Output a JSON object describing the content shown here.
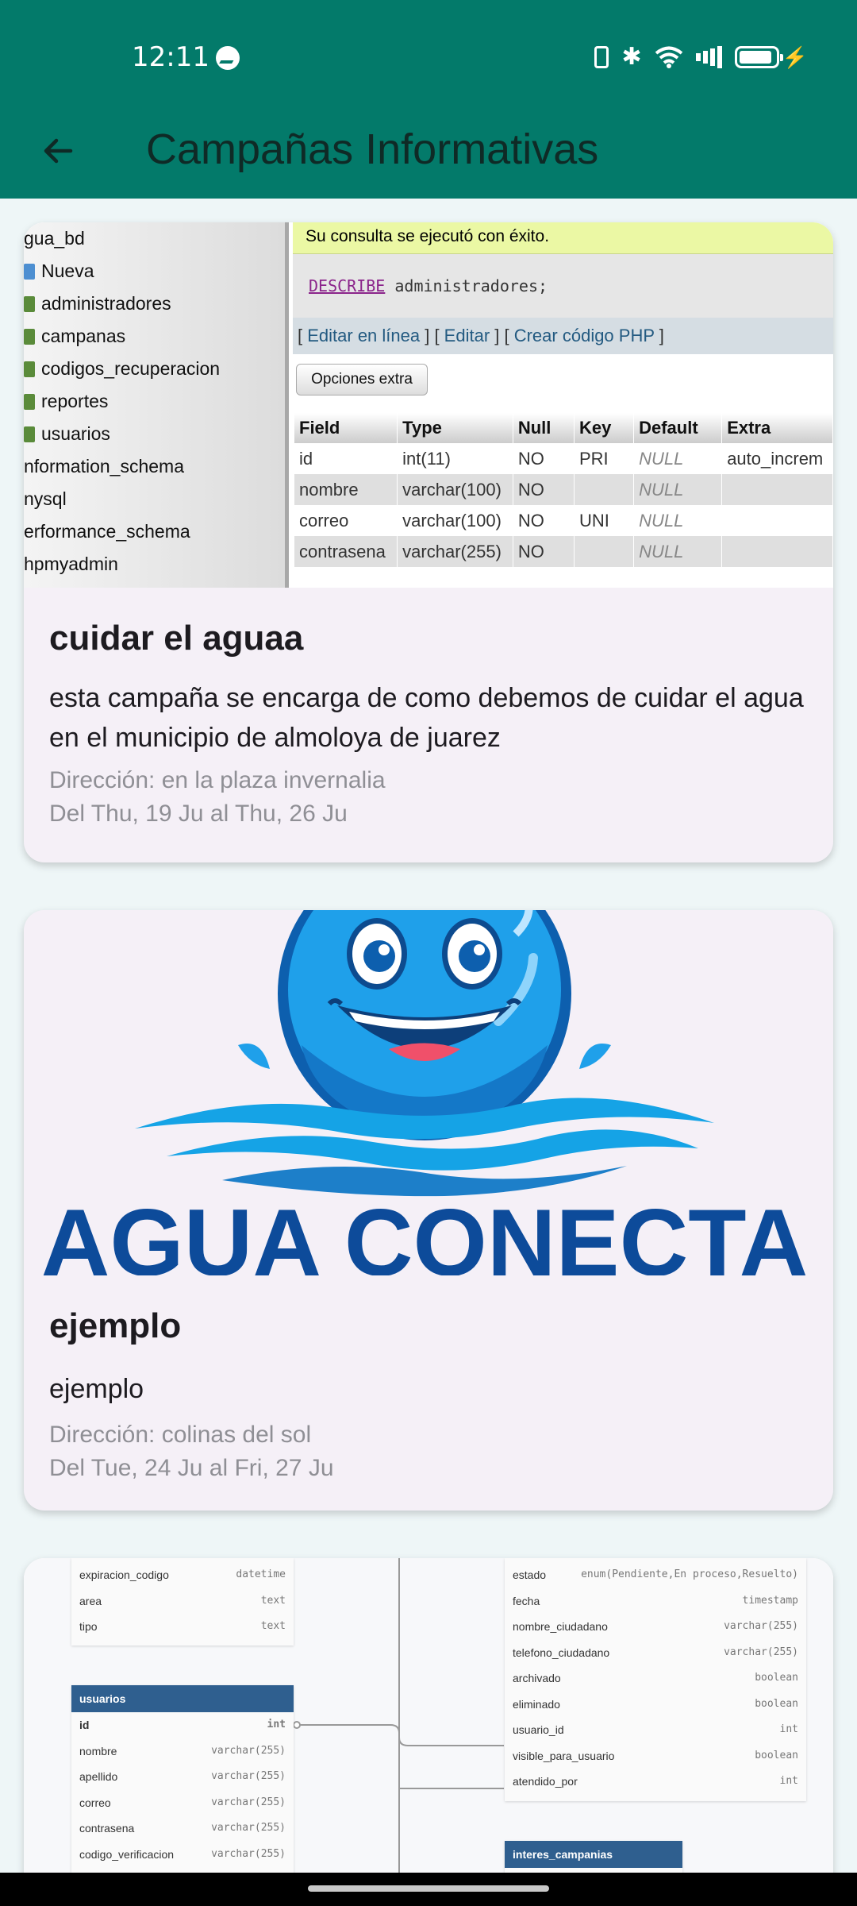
{
  "status_bar": {
    "time": "12:11",
    "icons": [
      "messenger-icon",
      "vibrate-icon",
      "bluetooth-icon",
      "wifi-icon",
      "signal-icon",
      "battery-icon",
      "charging-bolt-icon"
    ]
  },
  "app_bar": {
    "title": "Campañas Informativas",
    "back_icon": "arrow-back-icon",
    "color": "#037a6a"
  },
  "campaigns": [
    {
      "title": "cuidar el aguaa",
      "description": "esta campaña se encarga de como debemos de cuidar el agua en el municipio de almoloya de juarez",
      "address": "Dirección: en la plaza invernalia",
      "dates": "Del Thu, 19 Ju al Thu, 26 Ju",
      "image": {
        "sidebar": [
          "gua_bd",
          "Nueva",
          "administradores",
          "campanas",
          "codigos_recuperacion",
          "reportes",
          "usuarios",
          "nformation_schema",
          "nysql",
          "erformance_schema",
          "hpmyadmin"
        ],
        "success_msg": "Su consulta se ejecutó con éxito.",
        "sql_keyword": "DESCRIBE",
        "sql_rest": "administradores;",
        "links": [
          "Editar en línea",
          "Editar",
          "Crear código PHP"
        ],
        "button": "Opciones extra",
        "columns": [
          "Field",
          "Type",
          "Null",
          "Key",
          "Default",
          "Extra"
        ],
        "rows": [
          [
            "id",
            "int(11)",
            "NO",
            "PRI",
            "NULL",
            "auto_increm"
          ],
          [
            "nombre",
            "varchar(100)",
            "NO",
            "",
            "NULL",
            ""
          ],
          [
            "correo",
            "varchar(100)",
            "NO",
            "UNI",
            "NULL",
            ""
          ],
          [
            "contrasena",
            "varchar(255)",
            "NO",
            "",
            "NULL",
            ""
          ]
        ]
      }
    },
    {
      "title": "ejemplo",
      "description": "ejemplo",
      "address": "Dirección: colinas del sol",
      "dates": "Del Tue, 24 Ju al Fri, 27 Ju",
      "image": {
        "logo_text": "AGUA CONECTA"
      }
    },
    {
      "image": {
        "left_rows": [
          [
            "expiracion_codigo",
            "datetime"
          ],
          [
            "area",
            "text"
          ],
          [
            "tipo",
            "text"
          ]
        ],
        "usuarios_title": "usuarios",
        "usuarios_rows": [
          [
            "id",
            "int"
          ],
          [
            "nombre",
            "varchar(255)"
          ],
          [
            "apellido",
            "varchar(255)"
          ],
          [
            "correo",
            "varchar(255)"
          ],
          [
            "contrasena",
            "varchar(255)"
          ],
          [
            "codigo_verificacion",
            "varchar(255)"
          ]
        ],
        "right_rows": [
          [
            "estado",
            "enum(Pendiente,En proceso,Resuelto)"
          ],
          [
            "fecha",
            "timestamp"
          ],
          [
            "nombre_ciudadano",
            "varchar(255)"
          ],
          [
            "telefono_ciudadano",
            "varchar(255)"
          ],
          [
            "archivado",
            "boolean"
          ],
          [
            "eliminado",
            "boolean"
          ],
          [
            "usuario_id",
            "int"
          ],
          [
            "visible_para_usuario",
            "boolean"
          ],
          [
            "atendido_por",
            "int"
          ]
        ],
        "interes_title": "interes_campanias"
      }
    }
  ]
}
